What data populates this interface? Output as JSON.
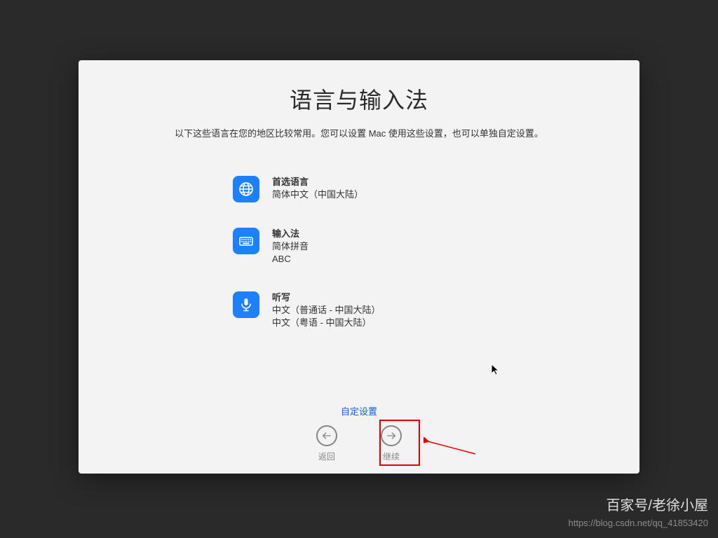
{
  "title": "语言与输入法",
  "subtitle": "以下这些语言在您的地区比较常用。您可以设置 Mac 使用这些设置，也可以单独自定设置。",
  "sections": {
    "language": {
      "label": "首选语言",
      "value": "简体中文（中国大陆）"
    },
    "input": {
      "label": "输入法",
      "value1": "简体拼音",
      "value2": "ABC"
    },
    "dictation": {
      "label": "听写",
      "value1": "中文（普通话 - 中国大陆）",
      "value2": "中文（粤语 - 中国大陆）"
    }
  },
  "customize": "自定设置",
  "nav": {
    "back": "返回",
    "continue": "继续"
  },
  "watermark1": "百家号/老徐小屋",
  "watermark2": "https://blog.csdn.net/qq_41853420",
  "colors": {
    "accent": "#1c80ff",
    "highlight": "#e30000"
  }
}
